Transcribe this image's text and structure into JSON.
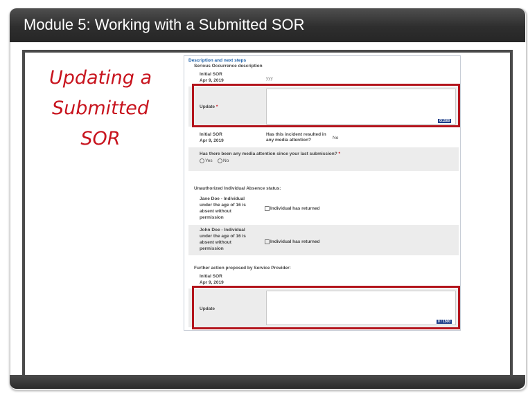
{
  "header": {
    "title": "Module 5:  Working with a Submitted SOR"
  },
  "slide": {
    "handwritten": [
      "Updating a",
      "Submitted",
      "SOR"
    ]
  },
  "form": {
    "section_title": "Description and next steps",
    "section_subtitle": "Serious Occurrence description",
    "initial_sor_label": "Initial SOR",
    "initial_sor_date": "Apr 9, 2019",
    "initial_description_value": "yyy",
    "update_label": "Update",
    "required_mark": "*",
    "counter_1": "0/1500",
    "media_question": "Has this incident resulted in any media attention?",
    "media_answer": "No",
    "media_since_question": "Has there been any media attention since your last submission?",
    "radio_yes": "Yes",
    "radio_no": "No",
    "absence_status_label": "Unauthorized Individual Absence status:",
    "absences": [
      {
        "name": [
          "Jane Doe - Individual",
          "under the age of 16 is",
          "absent without",
          "permission"
        ],
        "checkbox": "Individual has returned"
      },
      {
        "name": [
          "John Doe - Individual",
          "under the age of 16 is",
          "absent without",
          "permission"
        ],
        "checkbox": "Individual has returned"
      }
    ],
    "further_action_label": "Further action proposed by Service Provider:",
    "counter_2": "0 / 1500"
  }
}
